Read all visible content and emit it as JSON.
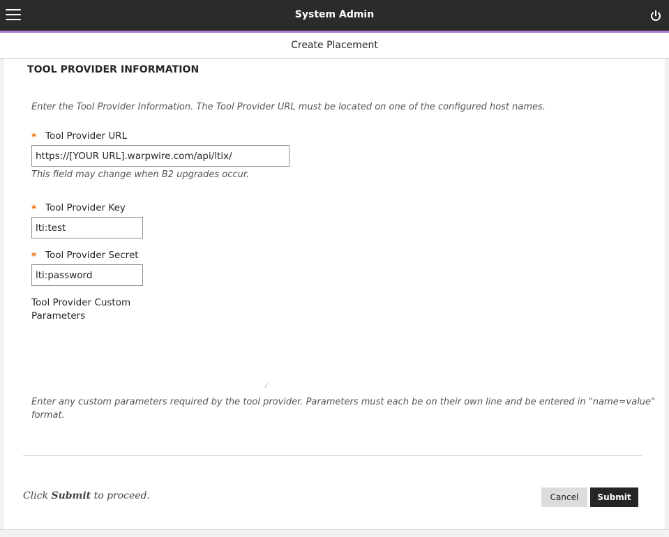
{
  "header": {
    "title": "System Admin",
    "menu_icon": "hamburger-menu-icon",
    "logout_icon": "power-icon",
    "accent_color": "#b57bd3"
  },
  "subheader": {
    "title": "Create Placement"
  },
  "section": {
    "title": "TOOL PROVIDER INFORMATION",
    "instructions": "Enter the Tool Provider Information. The Tool Provider URL must be located on one of the configured host names."
  },
  "fields": {
    "url": {
      "required_mark": "*",
      "label": "Tool Provider URL",
      "value": "https://[YOUR URL].warpwire.com/api/ltix/",
      "hint": "This field may change when B2 upgrades occur."
    },
    "key": {
      "required_mark": "*",
      "label": "Tool Provider Key",
      "value": "lti:test"
    },
    "secret": {
      "required_mark": "*",
      "label": "Tool Provider Secret",
      "value": "lti:password"
    },
    "custom": {
      "label_line1": "Tool Provider Custom",
      "label_line2": "Parameters",
      "value": "",
      "hint_line1": "Enter any custom parameters required by the tool provider. Parameters must each be on their own line and be entered in \"name=value\"",
      "hint_line2": "format."
    }
  },
  "footer": {
    "proceed_prefix": "Click",
    "proceed_bold": "Submit",
    "proceed_suffix": "to proceed.",
    "cancel_label": "Cancel",
    "submit_label": "Submit"
  }
}
